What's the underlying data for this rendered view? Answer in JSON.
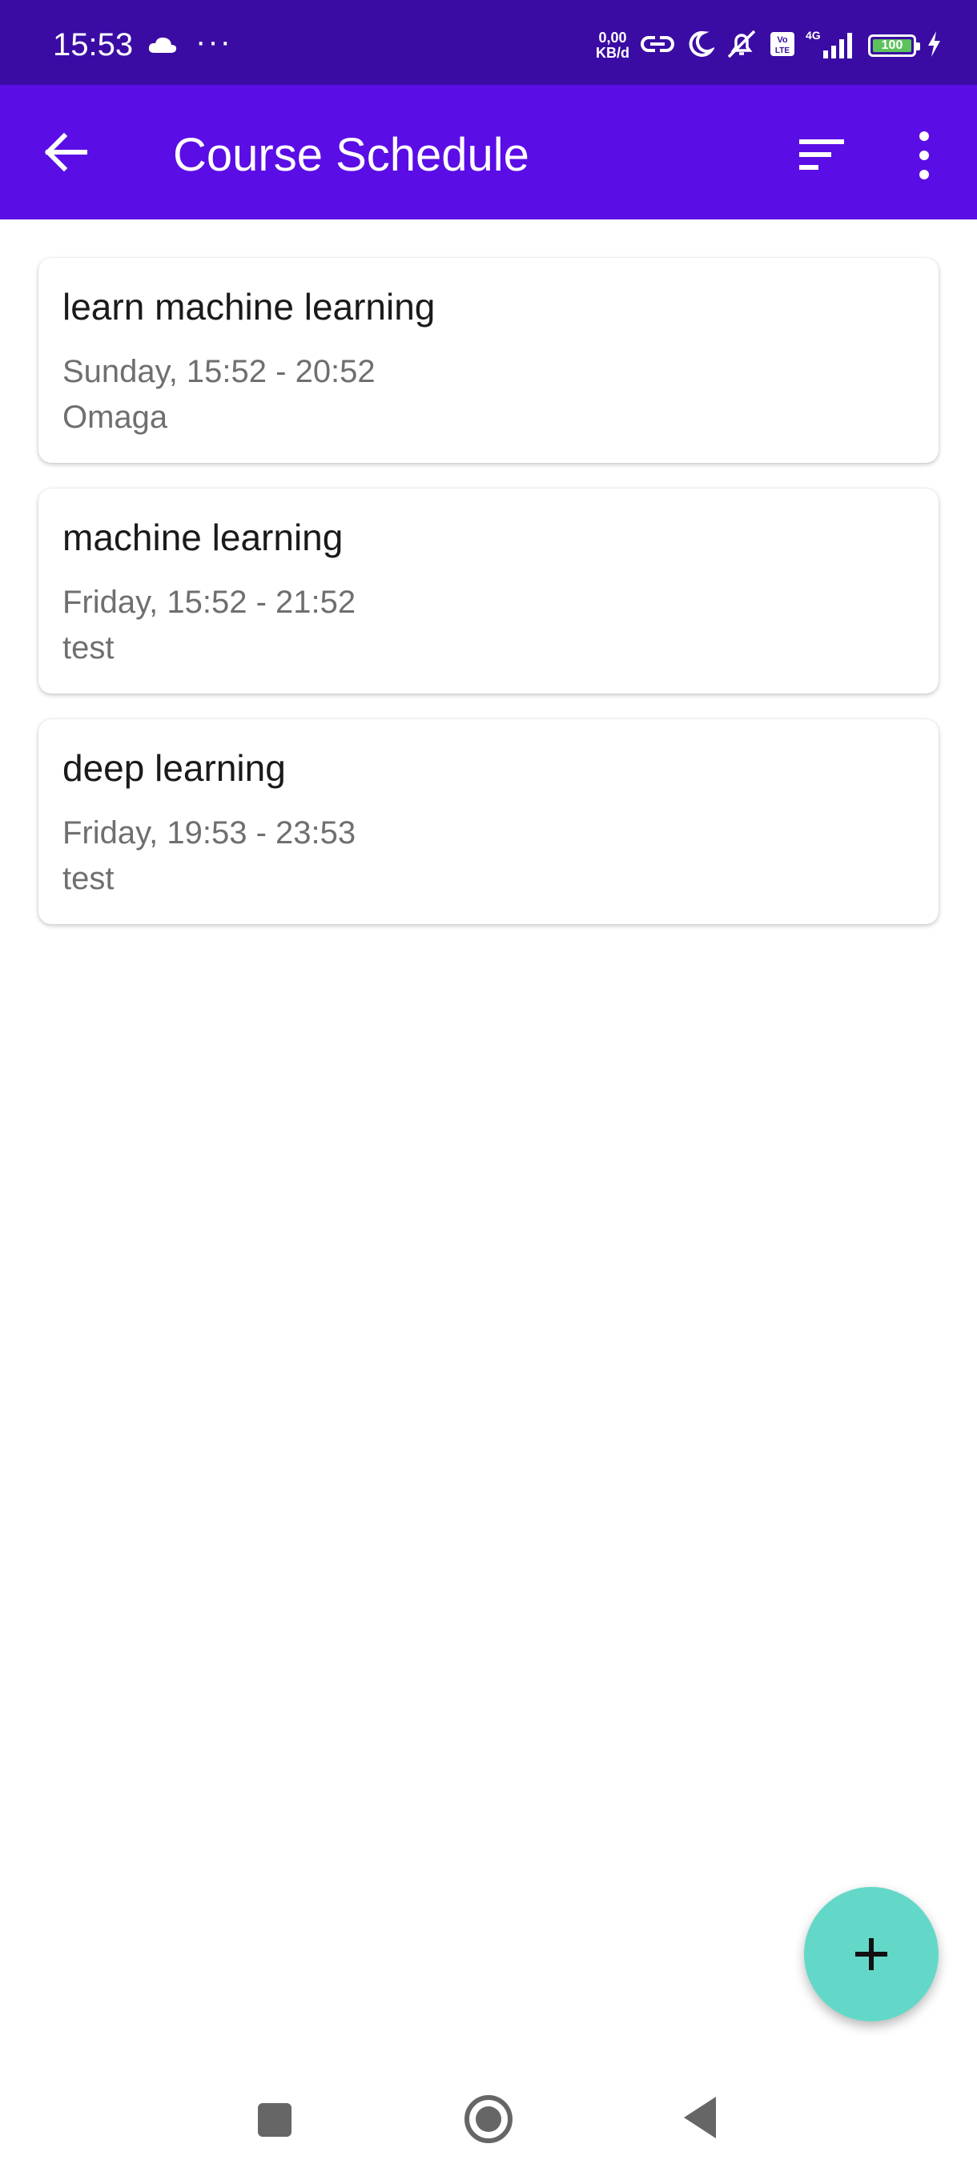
{
  "status_bar": {
    "time": "15:53",
    "data_speed_top": "0,00",
    "data_speed_bottom": "KB/d",
    "network": "4G",
    "volte_label_top": "Vo",
    "volte_label_bottom": "LTE",
    "battery": "100"
  },
  "app_bar": {
    "title": "Course Schedule"
  },
  "courses": [
    {
      "name": "learn machine learning",
      "time": "Sunday, 15:52 - 20:52",
      "location": "Omaga"
    },
    {
      "name": "machine learning",
      "time": "Friday, 15:52 - 21:52",
      "location": "test"
    },
    {
      "name": "deep learning",
      "time": "Friday, 19:53 - 23:53",
      "location": "test"
    }
  ],
  "colors": {
    "status_bar": "#3a0ca3",
    "app_bar": "#5b0de6",
    "fab": "#64d8c8",
    "battery_fill": "#5dc25b"
  }
}
